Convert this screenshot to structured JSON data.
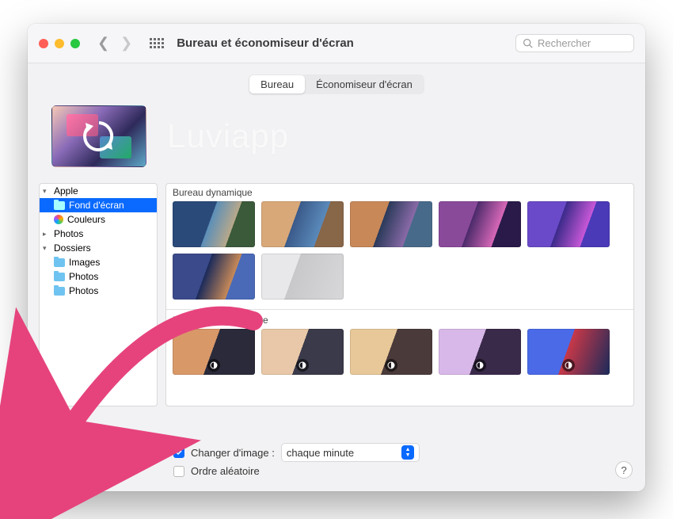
{
  "window": {
    "title": "Bureau et économiseur d'écran",
    "search_placeholder": "Rechercher"
  },
  "tabs": {
    "desktop": "Bureau",
    "screensaver": "Économiseur d'écran"
  },
  "watermark": "Luviapp",
  "sidebar": {
    "apple": {
      "label": "Apple",
      "wallpaper": "Fond d'écran",
      "colors": "Couleurs"
    },
    "photos_group": "Photos",
    "folders": {
      "label": "Dossiers",
      "items": [
        "Images",
        "Photos",
        "Photos"
      ]
    }
  },
  "sections": {
    "dynamic": "Bureau dynamique",
    "light_dark": "Bureau clair et sombre"
  },
  "options": {
    "change_image_label": "Changer d'image :",
    "interval": "chaque minute",
    "random": "Ordre aléatoire"
  }
}
